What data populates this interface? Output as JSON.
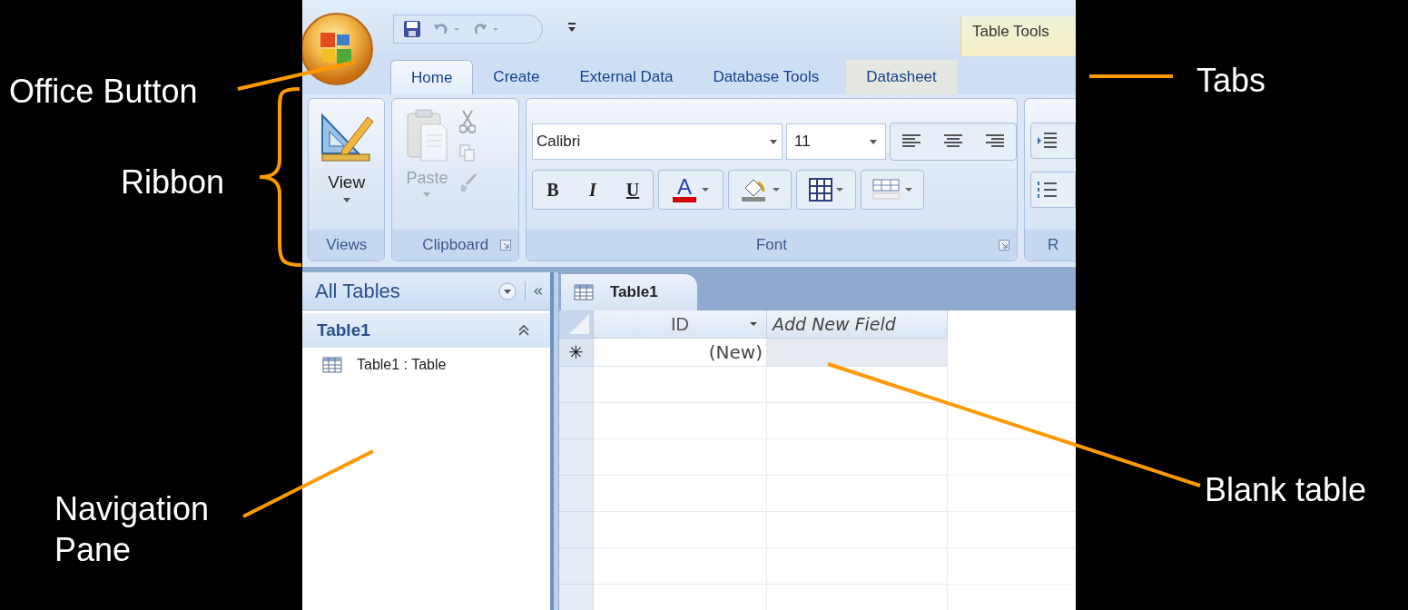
{
  "annotations": [
    {
      "kind": "office",
      "text": "Office Button"
    },
    {
      "kind": "tabs",
      "text": "Tabs"
    },
    {
      "kind": "ribbon",
      "text": "Ribbon"
    },
    {
      "kind": "nav",
      "text": "Navigation Pane"
    },
    {
      "kind": "table",
      "text": "Blank table"
    }
  ],
  "contextual_group": "Table Tools",
  "tabs": [
    {
      "label": "Home",
      "selected": true,
      "contextual": false
    },
    {
      "label": "Create",
      "selected": false,
      "contextual": false
    },
    {
      "label": "External Data",
      "selected": false,
      "contextual": false
    },
    {
      "label": "Database Tools",
      "selected": false,
      "contextual": false
    },
    {
      "label": "Datasheet",
      "selected": false,
      "contextual": true
    }
  ],
  "ribbon": {
    "views": {
      "button": "View",
      "label": "Views"
    },
    "clipboard": {
      "paste": "Paste",
      "disabled": true,
      "label": "Clipboard"
    },
    "font": {
      "font_name": "Calibri",
      "font_size": "11",
      "style_buttons": [
        "B",
        "I",
        "U"
      ],
      "font_color": "A",
      "label": "Font"
    },
    "cut_group_label": "R"
  },
  "navigation_pane": {
    "header": "All Tables",
    "groups": [
      {
        "label": "Table1",
        "expanded": true,
        "items": [
          "Table1 : Table"
        ]
      }
    ]
  },
  "document": {
    "tab": "Table1",
    "columns": [
      {
        "label": "ID",
        "kind": "field"
      },
      {
        "label": "Add New Field",
        "kind": "add"
      }
    ],
    "new_row": {
      "marker": "✳",
      "cells": [
        "(New)"
      ]
    }
  }
}
